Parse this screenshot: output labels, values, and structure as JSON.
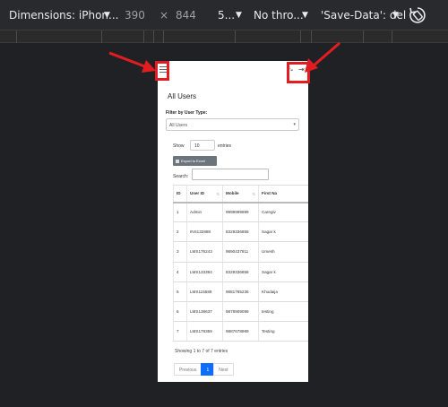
{
  "devtools": {
    "device": "Dimensions: iPhon...",
    "width": "390",
    "times": "×",
    "height": "844",
    "zoom": "5...",
    "throttle": "No thro...",
    "savedata": "'Save-Data': del",
    "caret": "▼",
    "rotate_icon": "rotate-icon"
  },
  "header": {
    "menu_icon": "hamburger-menu-icon",
    "expand_icon": "⤡",
    "logout_icon": "⇥"
  },
  "page": {
    "title": "All Users",
    "filter_label": "Filter by User Type:",
    "filter_value": "All Users",
    "filter_caret": "▾",
    "show_label": "Show",
    "show_value": "10",
    "entries_label": "entries",
    "export_label": "Export to Excel",
    "search_label": "Search:"
  },
  "table": {
    "headers": [
      "ID",
      "User ID",
      "Mobile",
      "First Na"
    ],
    "sort_glyph": "⇅",
    "rows": [
      [
        "1",
        "Admin",
        "9999999999",
        "Caregiv"
      ],
      [
        "2",
        "INS132888",
        "8329336858",
        "Sagar k"
      ],
      [
        "3",
        "LMS176243",
        "9890437811",
        "Umesh"
      ],
      [
        "4",
        "LMS133394",
        "8329336858",
        "Sagar k"
      ],
      [
        "5",
        "LMS115589",
        "9881765236",
        "Khudaija"
      ],
      [
        "6",
        "LMS138637",
        "9878909099",
        "testing"
      ],
      [
        "7",
        "LMS178359",
        "9887678989",
        "Testing"
      ]
    ]
  },
  "footer": {
    "info": "Showing 1 to 7 of 7 entries",
    "previous": "Previous",
    "page": "1",
    "next": "Next"
  },
  "annotation_color": "#e11d22"
}
